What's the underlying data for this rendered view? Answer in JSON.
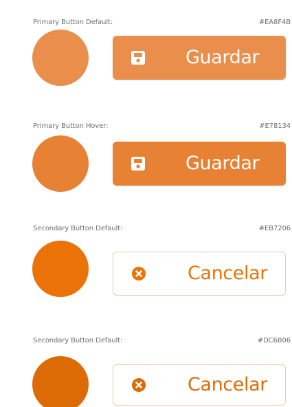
{
  "swatches": [
    {
      "label": "Primary Button Default:",
      "hex": "#EA8F4B",
      "color": "#EA8F4B",
      "button": {
        "style": "primary",
        "label": "Guardar",
        "icon": "save-icon"
      }
    },
    {
      "label": "Primary Button Hover:",
      "hex": "#E78134",
      "color": "#E78134",
      "button": {
        "style": "primary",
        "label": "Guardar",
        "icon": "save-icon"
      }
    },
    {
      "label": "Secondary Button Default:",
      "hex": "#EB7206",
      "color": "#EB7206",
      "button": {
        "style": "secondary",
        "label": "Cancelar",
        "icon": "times-circle-icon"
      }
    },
    {
      "label": "Secondary Button Default:",
      "hex": "#DC6B06",
      "color": "#DC6B06",
      "button": {
        "style": "secondary",
        "label": "Cancelar",
        "icon": "times-circle-icon"
      }
    }
  ]
}
